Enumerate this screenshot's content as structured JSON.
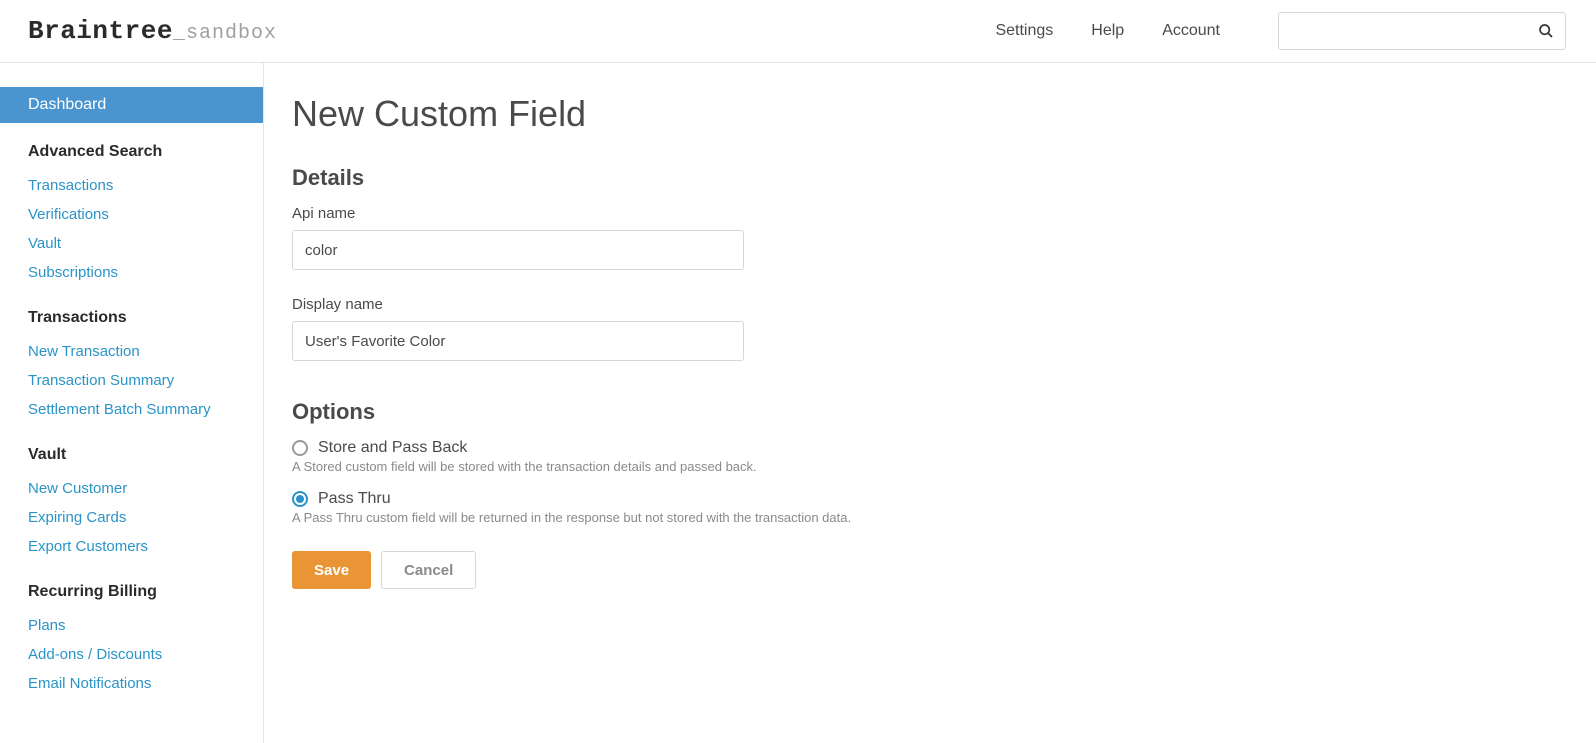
{
  "header": {
    "logo_main": "Braintree",
    "logo_suffix": "_sandbox",
    "nav": {
      "settings": "Settings",
      "help": "Help",
      "account": "Account"
    }
  },
  "sidebar": {
    "dashboard": "Dashboard",
    "groups": [
      {
        "title": "Advanced Search",
        "items": [
          "Transactions",
          "Verifications",
          "Vault",
          "Subscriptions"
        ]
      },
      {
        "title": "Transactions",
        "items": [
          "New Transaction",
          "Transaction Summary",
          "Settlement Batch Summary"
        ]
      },
      {
        "title": "Vault",
        "items": [
          "New Customer",
          "Expiring Cards",
          "Export Customers"
        ]
      },
      {
        "title": "Recurring Billing",
        "items": [
          "Plans",
          "Add-ons / Discounts",
          "Email Notifications"
        ]
      }
    ]
  },
  "main": {
    "title": "New Custom Field",
    "details": {
      "heading": "Details",
      "api_name_label": "Api name",
      "api_name_value": "color",
      "display_name_label": "Display name",
      "display_name_value": "User's Favorite Color"
    },
    "options": {
      "heading": "Options",
      "items": [
        {
          "label": "Store and Pass Back",
          "desc": "A Stored custom field will be stored with the transaction details and passed back.",
          "selected": false
        },
        {
          "label": "Pass Thru",
          "desc": "A Pass Thru custom field will be returned in the response but not stored with the transaction data.",
          "selected": true
        }
      ]
    },
    "buttons": {
      "save": "Save",
      "cancel": "Cancel"
    }
  }
}
